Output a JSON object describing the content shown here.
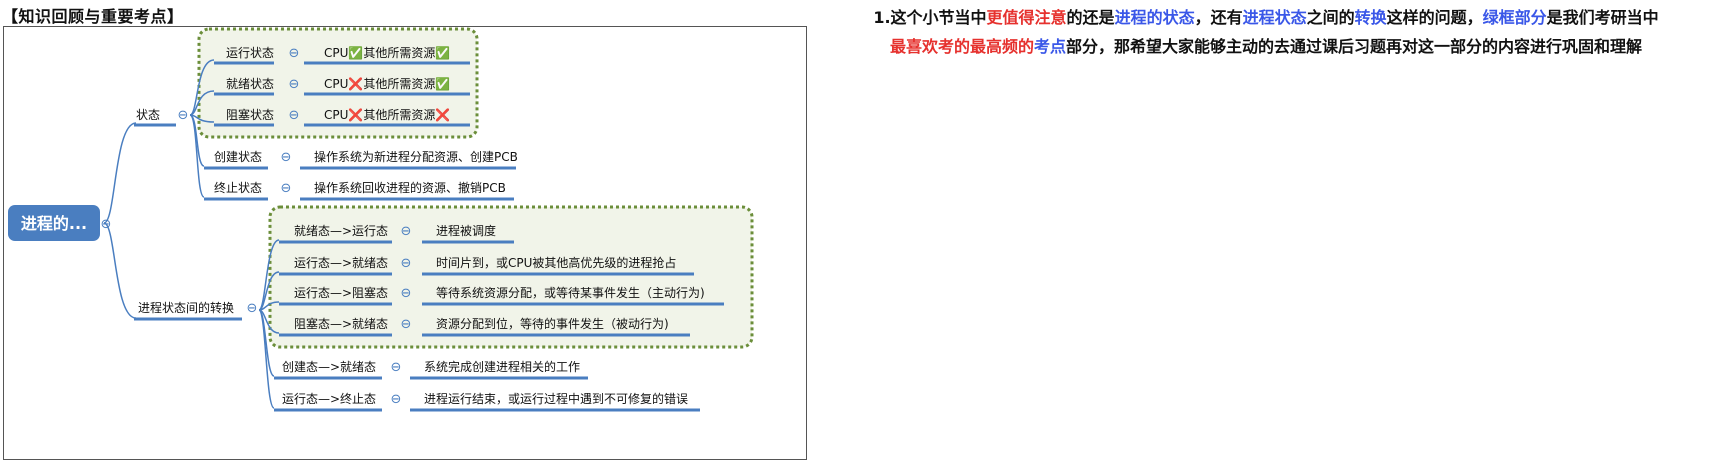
{
  "title": "【知识回顾与重要考点】",
  "mindmap": {
    "root": "进程的...",
    "branch_state": {
      "label": "状态",
      "items": [
        {
          "name": "运行状态",
          "desc_pre": "CPU",
          "mark1": "✅",
          "desc_mid": "其他所需资源",
          "mark2": "✅"
        },
        {
          "name": "就绪状态",
          "desc_pre": "CPU",
          "mark1": "❌",
          "desc_mid": "其他所需资源",
          "mark2": "✅"
        },
        {
          "name": "阻塞状态",
          "desc_pre": "CPU",
          "mark1": "❌",
          "desc_mid": "其他所需资源",
          "mark2": "❌"
        },
        {
          "name": "创建状态",
          "desc": "操作系统为新进程分配资源、创建PCB"
        },
        {
          "name": "终止状态",
          "desc": "操作系统回收进程的资源、撤销PCB"
        }
      ]
    },
    "branch_transition": {
      "label": "进程状态间的转换",
      "items": [
        {
          "name": "就绪态—>运行态",
          "desc": "进程被调度"
        },
        {
          "name": "运行态—>就绪态",
          "desc": "时间片到，或CPU被其他高优先级的进程抢占"
        },
        {
          "name": "运行态—>阻塞态",
          "desc": "等待系统资源分配，或等待某事件发生（主动行为)"
        },
        {
          "name": "阻塞态—>就绪态",
          "desc": "资源分配到位，等待的事件发生（被动行为)"
        },
        {
          "name": "创建态—>就绪态",
          "desc": "系统完成创建进程相关的工作"
        },
        {
          "name": "运行态—>终止态",
          "desc": "进程运行结束，或运行过程中遇到不可修复的错误"
        }
      ]
    },
    "collapse_symbol": "⊖"
  },
  "note": {
    "line1": [
      {
        "t": "1.这个小节当中",
        "c": "black"
      },
      {
        "t": "更值得注意",
        "c": "red"
      },
      {
        "t": "的还是",
        "c": "black"
      },
      {
        "t": "进程的状态",
        "c": "blue"
      },
      {
        "t": "，还有",
        "c": "black"
      },
      {
        "t": "进程状态",
        "c": "blue"
      },
      {
        "t": "之间的",
        "c": "black"
      },
      {
        "t": "转换",
        "c": "blue"
      },
      {
        "t": "这样的问题，",
        "c": "black"
      },
      {
        "t": "绿框部分",
        "c": "blue"
      },
      {
        "t": "是我们考研当中",
        "c": "black"
      }
    ],
    "line2": [
      {
        "t": "最喜欢考的最高频的",
        "c": "red"
      },
      {
        "t": "考点",
        "c": "blue"
      },
      {
        "t": "部分，那希望大家能够主动的去通过课后习题再对这一部分的内容进行巩固和理解",
        "c": "black"
      }
    ]
  },
  "colors": {
    "root_fill": "#4a7ec0",
    "line": "#4a7ec0",
    "dash_border": "#6b8e3a",
    "dash_fill": "#f1f4e9",
    "red": "#e6312e",
    "blue": "#3a57e8"
  }
}
